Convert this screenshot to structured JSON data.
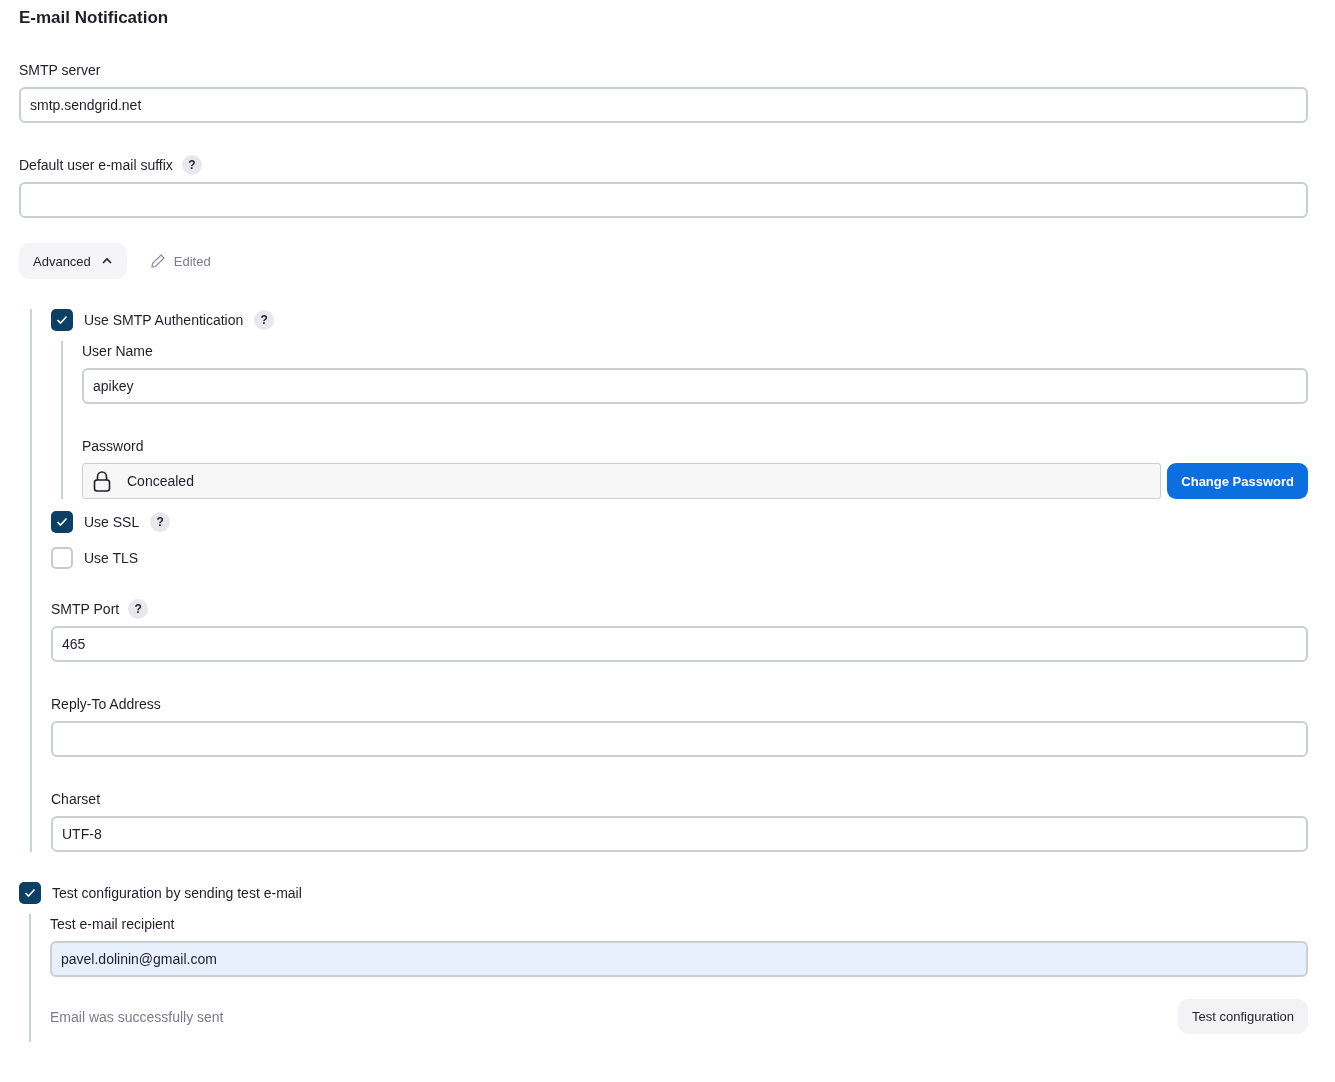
{
  "title": "E-mail Notification",
  "top_fields": [
    {
      "kind": "field",
      "label": "SMTP server",
      "value": "smtp.sendgrid.net"
    },
    {
      "kind": "field",
      "label": "Default user e-mail suffix",
      "help": "?"
    }
  ],
  "advanced": {
    "label": "Advanced",
    "expanded": true,
    "status": "Edited"
  },
  "advanced_items": [
    {
      "kind": "checkbox",
      "label": "Use SMTP Authentication",
      "checked": true,
      "help": "?",
      "children": [
        {
          "kind": "field",
          "label": "User Name",
          "value": "apikey"
        },
        {
          "kind": "password",
          "label": "Password",
          "value": "Concealed",
          "button": "Change Password"
        }
      ]
    },
    {
      "kind": "checkbox",
      "label": "Use SSL",
      "checked": true,
      "help": "?"
    },
    {
      "kind": "checkbox",
      "label": "Use TLS",
      "checked": false
    },
    {
      "kind": "field",
      "label": "SMTP Port",
      "value": "465",
      "help": "?"
    },
    {
      "kind": "field",
      "label": "Reply-To Address"
    },
    {
      "kind": "field",
      "label": "Charset",
      "value": "UTF-8"
    }
  ],
  "bottom_items": [
    {
      "kind": "checkbox",
      "label": "Test configuration by sending test e-mail",
      "checked": true,
      "children": [
        {
          "kind": "field",
          "label": "Test e-mail recipient",
          "value": "pavel.dolinin@gmail.com",
          "autofilled": true
        },
        {
          "kind": "result",
          "message": "Email was successfully sent",
          "button": "Test configuration"
        }
      ]
    }
  ]
}
